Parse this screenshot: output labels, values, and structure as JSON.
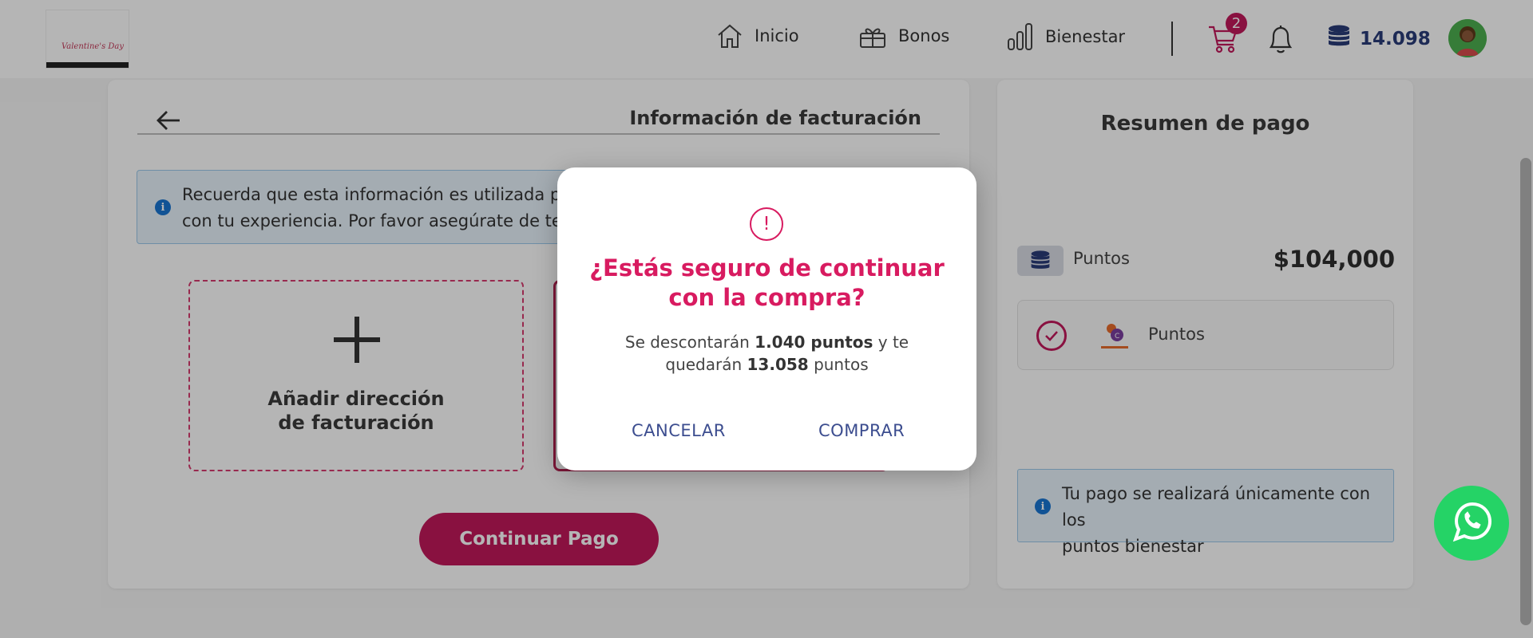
{
  "header": {
    "logo_text": "Valentine's Day",
    "nav": [
      {
        "label": "Inicio",
        "icon": "home-icon"
      },
      {
        "label": "Bonos",
        "icon": "gift-icon"
      },
      {
        "label": "Bienestar",
        "icon": "bar-chart-icon"
      }
    ],
    "cart_count": "2",
    "points_balance": "14.098"
  },
  "billing": {
    "title": "Información de facturación",
    "info_line1": "Recuerda que esta información es utilizada para",
    "info_line2": "con tu experiencia. Por favor asegúrate de tener",
    "add_address_line1": "Añadir dirección",
    "add_address_line2": "de facturación",
    "continue_label": "Continuar Pago"
  },
  "summary": {
    "title": "Resumen de pago",
    "points_label": "Puntos",
    "amount": "$104,000",
    "method_label": "Puntos",
    "note_line1": "Tu pago se realizará únicamente con los",
    "note_line2": "puntos bienestar"
  },
  "modal": {
    "icon_glyph": "!",
    "title_line1": "¿Estás seguro de continuar",
    "title_line2": "con la compra?",
    "body_pre": "Se descontarán",
    "body_points_discount": "1.040 puntos",
    "body_mid": "y te",
    "body_line2_pre": "quedarán",
    "body_points_remaining": "13.058",
    "body_line2_post": "puntos",
    "cancel_label": "CANCELAR",
    "confirm_label": "COMPRAR"
  },
  "colors": {
    "brand_pink": "#d81b60",
    "button_pink": "#c2185b",
    "link_blue": "#3c4d8f",
    "whatsapp_green": "#25d366"
  }
}
